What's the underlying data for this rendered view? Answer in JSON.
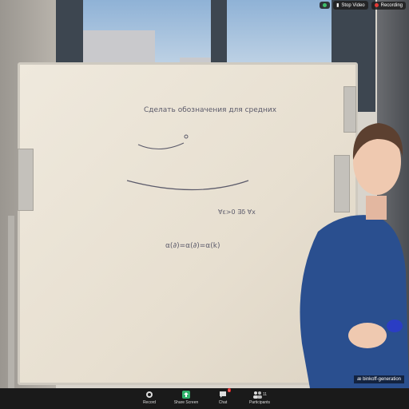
{
  "meeting": {
    "topbar": {
      "recording_label": "Recording",
      "stop_video_label": "Stop Video",
      "recording_color": "#e53935",
      "view_icon": "shield-icon"
    },
    "speaker_name": "æ binkoff-generation"
  },
  "whiteboard": {
    "line1": "Сделать обозначения для средних",
    "line2": "∀ε>0 ∃δ ∀x",
    "line3": "α(∂)=α(∂)=α(k)"
  },
  "toolbar": {
    "buttons": [
      {
        "label": "Record",
        "icon": "record-icon"
      },
      {
        "label": "Share Screen",
        "icon": "share-screen-icon",
        "color": "#2fb36b"
      },
      {
        "label": "Chat",
        "icon": "chat-icon",
        "badge": "1"
      },
      {
        "label": "Participants",
        "icon": "participants-icon",
        "count": "11"
      }
    ]
  }
}
